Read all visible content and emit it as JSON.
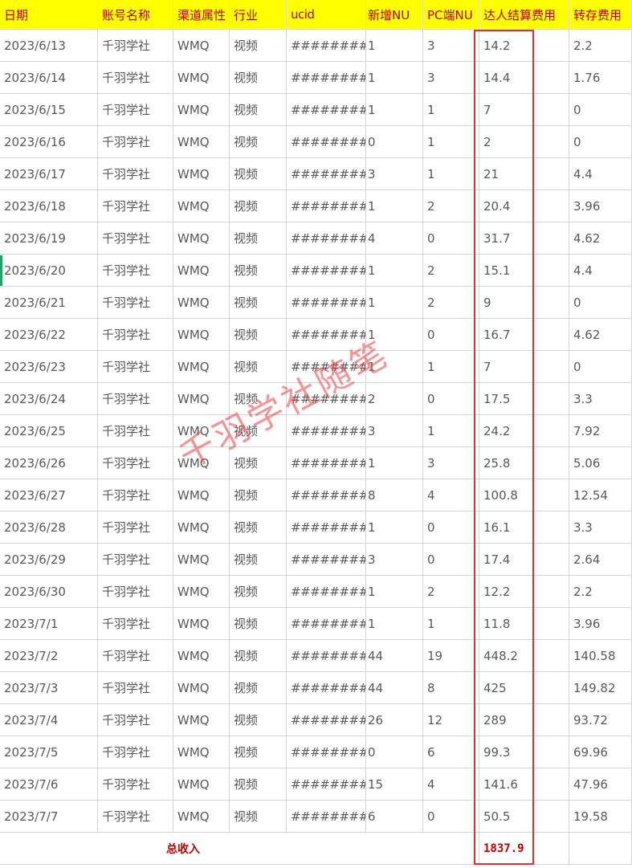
{
  "columns": [
    "日期",
    "账号名称",
    "渠道属性",
    "行业",
    "ucid",
    "新增NU",
    "PC端NU",
    "达人结算费用",
    "转存费用"
  ],
  "rows": [
    [
      "2023/6/13",
      "千羽学社",
      "WMQ",
      "视频",
      "##########",
      "1",
      "3",
      "14.2",
      "2.2"
    ],
    [
      "2023/6/14",
      "千羽学社",
      "WMQ",
      "视频",
      "##########",
      "1",
      "3",
      "14.4",
      "1.76"
    ],
    [
      "2023/6/15",
      "千羽学社",
      "WMQ",
      "视频",
      "##########",
      "1",
      "1",
      "7",
      "0"
    ],
    [
      "2023/6/16",
      "千羽学社",
      "WMQ",
      "视频",
      "##########",
      "0",
      "1",
      "2",
      "0"
    ],
    [
      "2023/6/17",
      "千羽学社",
      "WMQ",
      "视频",
      "##########",
      "3",
      "1",
      "21",
      "4.4"
    ],
    [
      "2023/6/18",
      "千羽学社",
      "WMQ",
      "视频",
      "##########",
      "1",
      "2",
      "20.4",
      "3.96"
    ],
    [
      "2023/6/19",
      "千羽学社",
      "WMQ",
      "视频",
      "##########",
      "4",
      "0",
      "31.7",
      "4.62"
    ],
    [
      "2023/6/20",
      "千羽学社",
      "WMQ",
      "视频",
      "##########",
      "1",
      "2",
      "15.1",
      "4.4"
    ],
    [
      "2023/6/21",
      "千羽学社",
      "WMQ",
      "视频",
      "##########",
      "1",
      "2",
      "9",
      "0"
    ],
    [
      "2023/6/22",
      "千羽学社",
      "WMQ",
      "视频",
      "##########",
      "1",
      "0",
      "16.7",
      "4.62"
    ],
    [
      "2023/6/23",
      "千羽学社",
      "WMQ",
      "视频",
      "##########",
      "1",
      "1",
      "7",
      "0"
    ],
    [
      "2023/6/24",
      "千羽学社",
      "WMQ",
      "视频",
      "##########",
      "2",
      "0",
      "17.5",
      "3.3"
    ],
    [
      "2023/6/25",
      "千羽学社",
      "WMQ",
      "视频",
      "##########",
      "3",
      "1",
      "24.2",
      "7.92"
    ],
    [
      "2023/6/26",
      "千羽学社",
      "WMQ",
      "视频",
      "##########",
      "1",
      "3",
      "25.8",
      "5.06"
    ],
    [
      "2023/6/27",
      "千羽学社",
      "WMQ",
      "视频",
      "##########",
      "8",
      "4",
      "100.8",
      "12.54"
    ],
    [
      "2023/6/28",
      "千羽学社",
      "WMQ",
      "视频",
      "##########",
      "1",
      "0",
      "16.1",
      "3.3"
    ],
    [
      "2023/6/29",
      "千羽学社",
      "WMQ",
      "视频",
      "##########",
      "3",
      "0",
      "17.4",
      "2.64"
    ],
    [
      "2023/6/30",
      "千羽学社",
      "WMQ",
      "视频",
      "##########",
      "1",
      "2",
      "12.2",
      "2.2"
    ],
    [
      "2023/7/1",
      "千羽学社",
      "WMQ",
      "视频",
      "##########",
      "1",
      "1",
      "11.8",
      "3.96"
    ],
    [
      "2023/7/2",
      "千羽学社",
      "WMQ",
      "视频",
      "##########",
      "44",
      "19",
      "448.2",
      "140.58"
    ],
    [
      "2023/7/3",
      "千羽学社",
      "WMQ",
      "视频",
      "##########",
      "44",
      "8",
      "425",
      "149.82"
    ],
    [
      "2023/7/4",
      "千羽学社",
      "WMQ",
      "视频",
      "##########",
      "26",
      "12",
      "289",
      "93.72"
    ],
    [
      "2023/7/5",
      "千羽学社",
      "WMQ",
      "视频",
      "##########",
      "0",
      "6",
      "99.3",
      "69.96"
    ],
    [
      "2023/7/6",
      "千羽学社",
      "WMQ",
      "视频",
      "##########",
      "15",
      "4",
      "141.6",
      "47.96"
    ],
    [
      "2023/7/7",
      "千羽学社",
      "WMQ",
      "视频",
      "##########",
      "6",
      "0",
      "50.5",
      "19.58"
    ]
  ],
  "total": {
    "label": "总收入",
    "value": "1837.9"
  },
  "watermark": "千羽学社随笔",
  "colors": {
    "header_bg": "#ffff00",
    "header_text": "#c00000",
    "highlight_border": "#e03030",
    "watermark": "#eb3c3c"
  }
}
